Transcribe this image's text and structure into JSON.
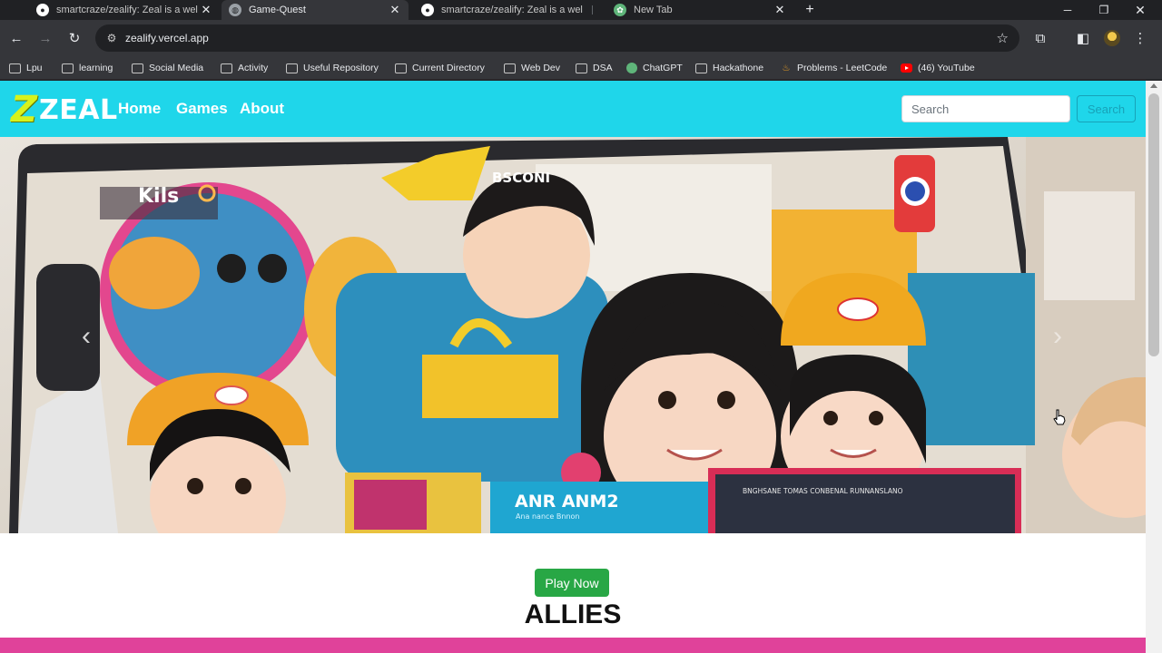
{
  "browser": {
    "tabs": [
      {
        "title": "smartcraze/zealify: Zeal is a wel",
        "icon": "github-icon",
        "active": false
      },
      {
        "title": "Game-Quest",
        "icon": "globe-icon",
        "active": true
      },
      {
        "title": "smartcraze/zealify: Zeal is a wel",
        "icon": "github-icon",
        "active": false
      },
      {
        "title": "New Tab",
        "icon": "chatgpt-icon",
        "active": false
      }
    ],
    "url": "zealify.vercel.app",
    "bookmarks": [
      {
        "label": "Lpu",
        "icon": "folder-icon"
      },
      {
        "label": "learning",
        "icon": "folder-icon"
      },
      {
        "label": "Social Media",
        "icon": "folder-icon"
      },
      {
        "label": "Activity",
        "icon": "folder-icon"
      },
      {
        "label": "Useful Repository",
        "icon": "folder-icon"
      },
      {
        "label": "Current Directory",
        "icon": "folder-icon"
      },
      {
        "label": "Web Dev",
        "icon": "folder-icon"
      },
      {
        "label": "DSA",
        "icon": "folder-icon"
      },
      {
        "label": "ChatGPT",
        "icon": "chatgpt-icon"
      },
      {
        "label": "Hackathone",
        "icon": "folder-icon"
      },
      {
        "label": "Problems - LeetCode",
        "icon": "leetcode-icon"
      },
      {
        "label": "(46) YouTube",
        "icon": "youtube-icon"
      }
    ]
  },
  "site": {
    "logo_mark": "Z",
    "logo_text": "ZEAL",
    "nav": [
      {
        "label": "Home"
      },
      {
        "label": "Games"
      },
      {
        "label": "About"
      }
    ],
    "search": {
      "placeholder": "Search",
      "button_label": "Search"
    },
    "hero": {
      "image_texts": {
        "sign": "Kils",
        "hat": "BSCONI",
        "screen_title": "ANR ANM2",
        "screen_sub": "Ana nance Bnnon",
        "poster": "BNGHSANE TOMAS CONBENAL RUNNANSLANO"
      }
    },
    "play_button": "Play Now",
    "section_title": "ALLIES"
  },
  "colors": {
    "navbar": "#1fd6ea",
    "logo_accent": "#d6f21d",
    "play_button": "#28a745",
    "pink_bar": "#e0429a",
    "search_outline": "#17a2b8"
  }
}
